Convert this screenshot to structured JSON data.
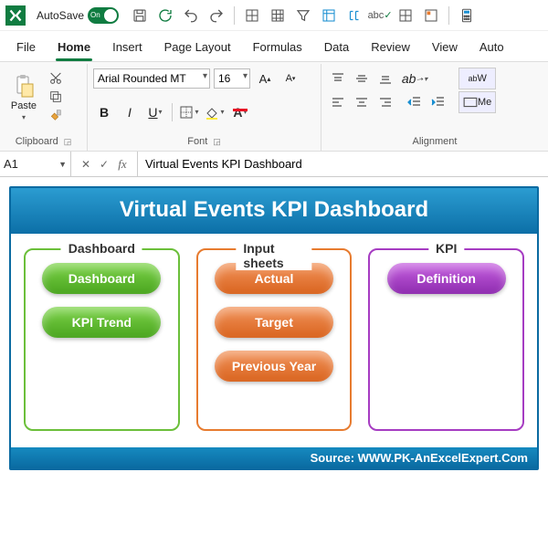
{
  "qat": {
    "autosave_label": "AutoSave",
    "autosave_state": "On"
  },
  "tabs": {
    "file": "File",
    "home": "Home",
    "insert": "Insert",
    "page_layout": "Page Layout",
    "formulas": "Formulas",
    "data": "Data",
    "review": "Review",
    "view": "View",
    "automate": "Auto"
  },
  "ribbon": {
    "clipboard": {
      "paste": "Paste",
      "label": "Clipboard"
    },
    "font": {
      "name": "Arial Rounded MT",
      "size": "16",
      "label": "Font",
      "bold": "B",
      "italic": "I",
      "underline": "U"
    },
    "alignment": {
      "label": "Alignment",
      "wrap": "W",
      "merge": "Me"
    }
  },
  "formula_bar": {
    "cell": "A1",
    "value": "Virtual Events KPI Dashboard"
  },
  "dashboard": {
    "title": "Virtual Events KPI Dashboard",
    "panels": [
      {
        "legend": "Dashboard",
        "color": "green",
        "buttons": [
          "Dashboard",
          "KPI Trend"
        ]
      },
      {
        "legend": "Input sheets",
        "color": "orange",
        "buttons": [
          "Actual",
          "Target",
          "Previous Year"
        ]
      },
      {
        "legend": "KPI",
        "color": "purple",
        "buttons": [
          "Definition"
        ]
      }
    ],
    "footer": "Source: WWW.PK-AnExcelExpert.Com"
  }
}
